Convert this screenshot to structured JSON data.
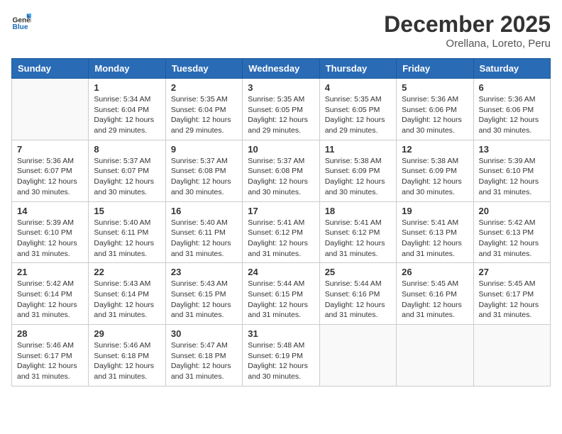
{
  "header": {
    "logo_general": "General",
    "logo_blue": "Blue",
    "month_title": "December 2025",
    "subtitle": "Orellana, Loreto, Peru"
  },
  "days_of_week": [
    "Sunday",
    "Monday",
    "Tuesday",
    "Wednesday",
    "Thursday",
    "Friday",
    "Saturday"
  ],
  "weeks": [
    [
      {
        "day": "",
        "info": ""
      },
      {
        "day": "1",
        "info": "Sunrise: 5:34 AM\nSunset: 6:04 PM\nDaylight: 12 hours\nand 29 minutes."
      },
      {
        "day": "2",
        "info": "Sunrise: 5:35 AM\nSunset: 6:04 PM\nDaylight: 12 hours\nand 29 minutes."
      },
      {
        "day": "3",
        "info": "Sunrise: 5:35 AM\nSunset: 6:05 PM\nDaylight: 12 hours\nand 29 minutes."
      },
      {
        "day": "4",
        "info": "Sunrise: 5:35 AM\nSunset: 6:05 PM\nDaylight: 12 hours\nand 29 minutes."
      },
      {
        "day": "5",
        "info": "Sunrise: 5:36 AM\nSunset: 6:06 PM\nDaylight: 12 hours\nand 30 minutes."
      },
      {
        "day": "6",
        "info": "Sunrise: 5:36 AM\nSunset: 6:06 PM\nDaylight: 12 hours\nand 30 minutes."
      }
    ],
    [
      {
        "day": "7",
        "info": "Sunrise: 5:36 AM\nSunset: 6:07 PM\nDaylight: 12 hours\nand 30 minutes."
      },
      {
        "day": "8",
        "info": "Sunrise: 5:37 AM\nSunset: 6:07 PM\nDaylight: 12 hours\nand 30 minutes."
      },
      {
        "day": "9",
        "info": "Sunrise: 5:37 AM\nSunset: 6:08 PM\nDaylight: 12 hours\nand 30 minutes."
      },
      {
        "day": "10",
        "info": "Sunrise: 5:37 AM\nSunset: 6:08 PM\nDaylight: 12 hours\nand 30 minutes."
      },
      {
        "day": "11",
        "info": "Sunrise: 5:38 AM\nSunset: 6:09 PM\nDaylight: 12 hours\nand 30 minutes."
      },
      {
        "day": "12",
        "info": "Sunrise: 5:38 AM\nSunset: 6:09 PM\nDaylight: 12 hours\nand 30 minutes."
      },
      {
        "day": "13",
        "info": "Sunrise: 5:39 AM\nSunset: 6:10 PM\nDaylight: 12 hours\nand 31 minutes."
      }
    ],
    [
      {
        "day": "14",
        "info": "Sunrise: 5:39 AM\nSunset: 6:10 PM\nDaylight: 12 hours\nand 31 minutes."
      },
      {
        "day": "15",
        "info": "Sunrise: 5:40 AM\nSunset: 6:11 PM\nDaylight: 12 hours\nand 31 minutes."
      },
      {
        "day": "16",
        "info": "Sunrise: 5:40 AM\nSunset: 6:11 PM\nDaylight: 12 hours\nand 31 minutes."
      },
      {
        "day": "17",
        "info": "Sunrise: 5:41 AM\nSunset: 6:12 PM\nDaylight: 12 hours\nand 31 minutes."
      },
      {
        "day": "18",
        "info": "Sunrise: 5:41 AM\nSunset: 6:12 PM\nDaylight: 12 hours\nand 31 minutes."
      },
      {
        "day": "19",
        "info": "Sunrise: 5:41 AM\nSunset: 6:13 PM\nDaylight: 12 hours\nand 31 minutes."
      },
      {
        "day": "20",
        "info": "Sunrise: 5:42 AM\nSunset: 6:13 PM\nDaylight: 12 hours\nand 31 minutes."
      }
    ],
    [
      {
        "day": "21",
        "info": "Sunrise: 5:42 AM\nSunset: 6:14 PM\nDaylight: 12 hours\nand 31 minutes."
      },
      {
        "day": "22",
        "info": "Sunrise: 5:43 AM\nSunset: 6:14 PM\nDaylight: 12 hours\nand 31 minutes."
      },
      {
        "day": "23",
        "info": "Sunrise: 5:43 AM\nSunset: 6:15 PM\nDaylight: 12 hours\nand 31 minutes."
      },
      {
        "day": "24",
        "info": "Sunrise: 5:44 AM\nSunset: 6:15 PM\nDaylight: 12 hours\nand 31 minutes."
      },
      {
        "day": "25",
        "info": "Sunrise: 5:44 AM\nSunset: 6:16 PM\nDaylight: 12 hours\nand 31 minutes."
      },
      {
        "day": "26",
        "info": "Sunrise: 5:45 AM\nSunset: 6:16 PM\nDaylight: 12 hours\nand 31 minutes."
      },
      {
        "day": "27",
        "info": "Sunrise: 5:45 AM\nSunset: 6:17 PM\nDaylight: 12 hours\nand 31 minutes."
      }
    ],
    [
      {
        "day": "28",
        "info": "Sunrise: 5:46 AM\nSunset: 6:17 PM\nDaylight: 12 hours\nand 31 minutes."
      },
      {
        "day": "29",
        "info": "Sunrise: 5:46 AM\nSunset: 6:18 PM\nDaylight: 12 hours\nand 31 minutes."
      },
      {
        "day": "30",
        "info": "Sunrise: 5:47 AM\nSunset: 6:18 PM\nDaylight: 12 hours\nand 31 minutes."
      },
      {
        "day": "31",
        "info": "Sunrise: 5:48 AM\nSunset: 6:19 PM\nDaylight: 12 hours\nand 30 minutes."
      },
      {
        "day": "",
        "info": ""
      },
      {
        "day": "",
        "info": ""
      },
      {
        "day": "",
        "info": ""
      }
    ]
  ]
}
